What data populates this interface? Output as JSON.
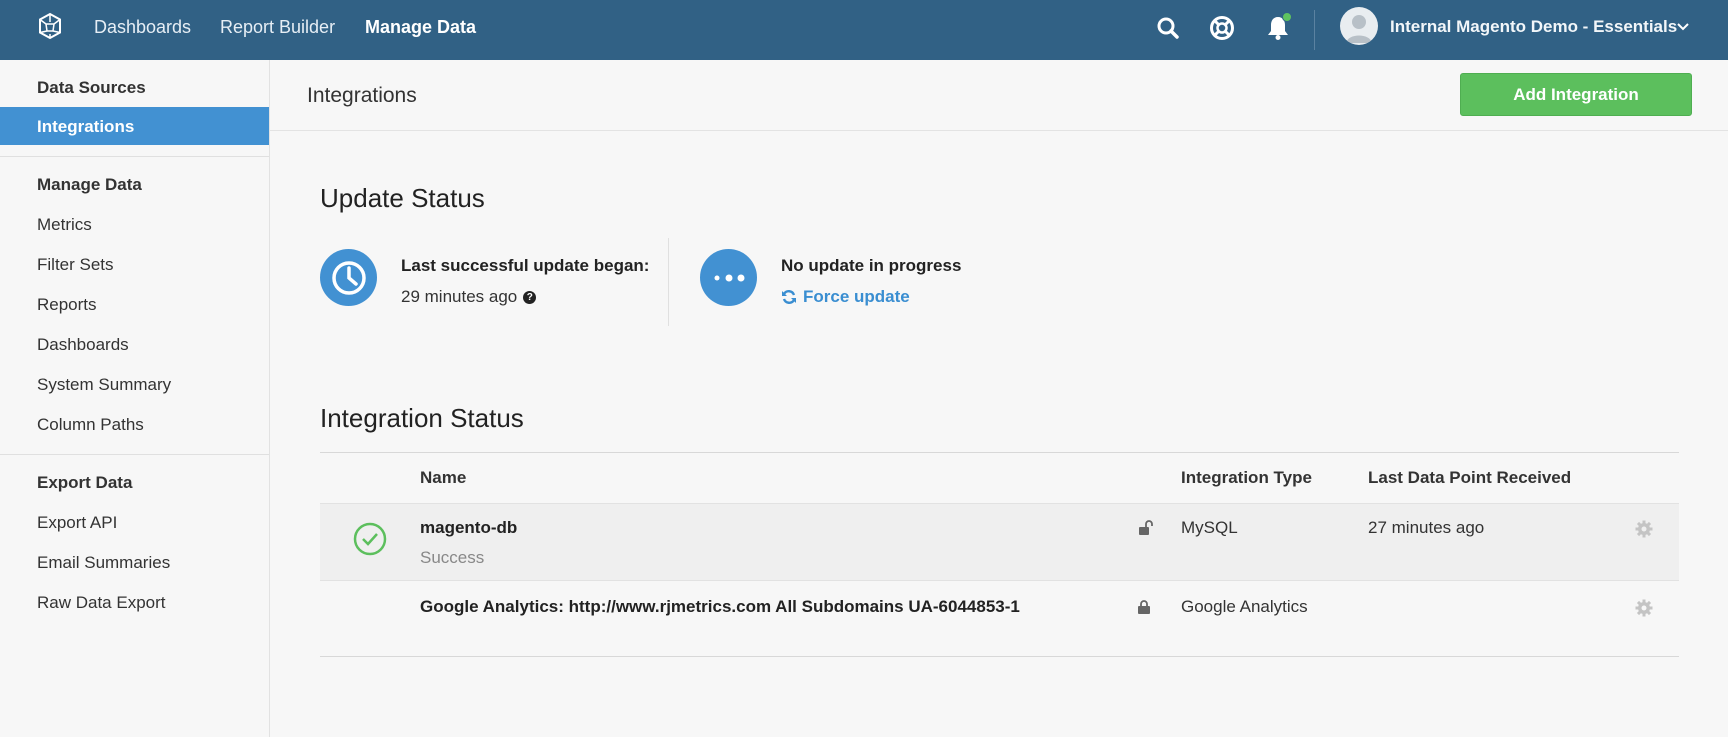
{
  "topbar": {
    "nav": [
      "Dashboards",
      "Report Builder",
      "Manage Data"
    ],
    "account_name": "Internal Magento Demo - Essentials"
  },
  "sidebar": {
    "data_sources": {
      "heading": "Data Sources",
      "items": [
        "Integrations"
      ]
    },
    "manage_data": {
      "heading": "Manage Data",
      "items": [
        "Metrics",
        "Filter Sets",
        "Reports",
        "Dashboards",
        "System Summary",
        "Column Paths"
      ]
    },
    "export_data": {
      "heading": "Export Data",
      "items": [
        "Export API",
        "Email Summaries",
        "Raw Data Export"
      ]
    }
  },
  "main": {
    "page_title": "Integrations",
    "add_button": "Add Integration",
    "update_status": {
      "title": "Update Status",
      "last_label": "Last successful update began:",
      "last_value": "29 minutes ago",
      "progress_label": "No update in progress",
      "force_link": "Force update"
    },
    "integration_status": {
      "title": "Integration Status",
      "columns": [
        "Name",
        "Integration Type",
        "Last Data Point Received"
      ],
      "rows": [
        {
          "name": "magento-db",
          "status": "Success",
          "type": "MySQL",
          "last": "27 minutes ago",
          "lock": "unlocked"
        },
        {
          "name": "Google Analytics: http://www.rjmetrics.com All Subdomains UA-6044853-1",
          "status": "",
          "type": "Google Analytics",
          "last": "",
          "lock": "locked"
        }
      ]
    }
  },
  "colors": {
    "topbar": "#316185",
    "accent_blue": "#4291d2",
    "success_green": "#5cbf5d"
  }
}
